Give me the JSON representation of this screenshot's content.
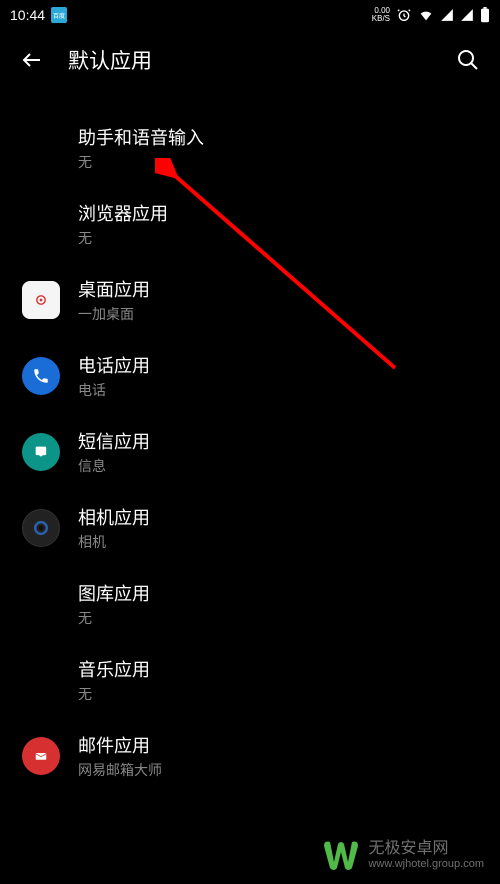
{
  "status": {
    "time": "10:44",
    "net_speed": "0.00",
    "net_unit": "KB/S"
  },
  "header": {
    "title": "默认应用"
  },
  "items": [
    {
      "title": "助手和语音输入",
      "sub": "无"
    },
    {
      "title": "浏览器应用",
      "sub": "无"
    },
    {
      "title": "桌面应用",
      "sub": "一加桌面"
    },
    {
      "title": "电话应用",
      "sub": "电话"
    },
    {
      "title": "短信应用",
      "sub": "信息"
    },
    {
      "title": "相机应用",
      "sub": "相机"
    },
    {
      "title": "图库应用",
      "sub": "无"
    },
    {
      "title": "音乐应用",
      "sub": "无"
    },
    {
      "title": "邮件应用",
      "sub": "网易邮箱大师"
    }
  ],
  "watermark": {
    "name": "无极安卓网",
    "url": "www.wjhotel.group.com"
  }
}
